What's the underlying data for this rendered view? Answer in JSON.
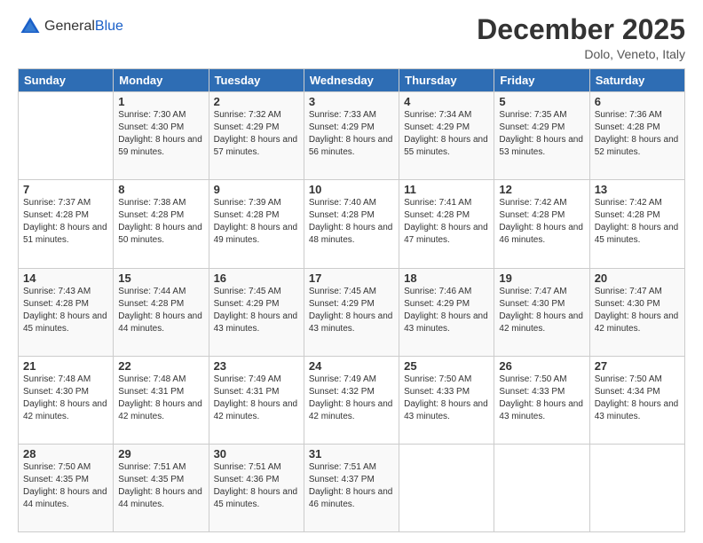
{
  "header": {
    "logo_general": "General",
    "logo_blue": "Blue",
    "month_title": "December 2025",
    "location": "Dolo, Veneto, Italy"
  },
  "days_of_week": [
    "Sunday",
    "Monday",
    "Tuesday",
    "Wednesday",
    "Thursday",
    "Friday",
    "Saturday"
  ],
  "weeks": [
    [
      {
        "day": "",
        "sunrise": "",
        "sunset": "",
        "daylight": ""
      },
      {
        "day": "1",
        "sunrise": "Sunrise: 7:30 AM",
        "sunset": "Sunset: 4:30 PM",
        "daylight": "Daylight: 8 hours and 59 minutes."
      },
      {
        "day": "2",
        "sunrise": "Sunrise: 7:32 AM",
        "sunset": "Sunset: 4:29 PM",
        "daylight": "Daylight: 8 hours and 57 minutes."
      },
      {
        "day": "3",
        "sunrise": "Sunrise: 7:33 AM",
        "sunset": "Sunset: 4:29 PM",
        "daylight": "Daylight: 8 hours and 56 minutes."
      },
      {
        "day": "4",
        "sunrise": "Sunrise: 7:34 AM",
        "sunset": "Sunset: 4:29 PM",
        "daylight": "Daylight: 8 hours and 55 minutes."
      },
      {
        "day": "5",
        "sunrise": "Sunrise: 7:35 AM",
        "sunset": "Sunset: 4:29 PM",
        "daylight": "Daylight: 8 hours and 53 minutes."
      },
      {
        "day": "6",
        "sunrise": "Sunrise: 7:36 AM",
        "sunset": "Sunset: 4:28 PM",
        "daylight": "Daylight: 8 hours and 52 minutes."
      }
    ],
    [
      {
        "day": "7",
        "sunrise": "Sunrise: 7:37 AM",
        "sunset": "Sunset: 4:28 PM",
        "daylight": "Daylight: 8 hours and 51 minutes."
      },
      {
        "day": "8",
        "sunrise": "Sunrise: 7:38 AM",
        "sunset": "Sunset: 4:28 PM",
        "daylight": "Daylight: 8 hours and 50 minutes."
      },
      {
        "day": "9",
        "sunrise": "Sunrise: 7:39 AM",
        "sunset": "Sunset: 4:28 PM",
        "daylight": "Daylight: 8 hours and 49 minutes."
      },
      {
        "day": "10",
        "sunrise": "Sunrise: 7:40 AM",
        "sunset": "Sunset: 4:28 PM",
        "daylight": "Daylight: 8 hours and 48 minutes."
      },
      {
        "day": "11",
        "sunrise": "Sunrise: 7:41 AM",
        "sunset": "Sunset: 4:28 PM",
        "daylight": "Daylight: 8 hours and 47 minutes."
      },
      {
        "day": "12",
        "sunrise": "Sunrise: 7:42 AM",
        "sunset": "Sunset: 4:28 PM",
        "daylight": "Daylight: 8 hours and 46 minutes."
      },
      {
        "day": "13",
        "sunrise": "Sunrise: 7:42 AM",
        "sunset": "Sunset: 4:28 PM",
        "daylight": "Daylight: 8 hours and 45 minutes."
      }
    ],
    [
      {
        "day": "14",
        "sunrise": "Sunrise: 7:43 AM",
        "sunset": "Sunset: 4:28 PM",
        "daylight": "Daylight: 8 hours and 45 minutes."
      },
      {
        "day": "15",
        "sunrise": "Sunrise: 7:44 AM",
        "sunset": "Sunset: 4:28 PM",
        "daylight": "Daylight: 8 hours and 44 minutes."
      },
      {
        "day": "16",
        "sunrise": "Sunrise: 7:45 AM",
        "sunset": "Sunset: 4:29 PM",
        "daylight": "Daylight: 8 hours and 43 minutes."
      },
      {
        "day": "17",
        "sunrise": "Sunrise: 7:45 AM",
        "sunset": "Sunset: 4:29 PM",
        "daylight": "Daylight: 8 hours and 43 minutes."
      },
      {
        "day": "18",
        "sunrise": "Sunrise: 7:46 AM",
        "sunset": "Sunset: 4:29 PM",
        "daylight": "Daylight: 8 hours and 43 minutes."
      },
      {
        "day": "19",
        "sunrise": "Sunrise: 7:47 AM",
        "sunset": "Sunset: 4:30 PM",
        "daylight": "Daylight: 8 hours and 42 minutes."
      },
      {
        "day": "20",
        "sunrise": "Sunrise: 7:47 AM",
        "sunset": "Sunset: 4:30 PM",
        "daylight": "Daylight: 8 hours and 42 minutes."
      }
    ],
    [
      {
        "day": "21",
        "sunrise": "Sunrise: 7:48 AM",
        "sunset": "Sunset: 4:30 PM",
        "daylight": "Daylight: 8 hours and 42 minutes."
      },
      {
        "day": "22",
        "sunrise": "Sunrise: 7:48 AM",
        "sunset": "Sunset: 4:31 PM",
        "daylight": "Daylight: 8 hours and 42 minutes."
      },
      {
        "day": "23",
        "sunrise": "Sunrise: 7:49 AM",
        "sunset": "Sunset: 4:31 PM",
        "daylight": "Daylight: 8 hours and 42 minutes."
      },
      {
        "day": "24",
        "sunrise": "Sunrise: 7:49 AM",
        "sunset": "Sunset: 4:32 PM",
        "daylight": "Daylight: 8 hours and 42 minutes."
      },
      {
        "day": "25",
        "sunrise": "Sunrise: 7:50 AM",
        "sunset": "Sunset: 4:33 PM",
        "daylight": "Daylight: 8 hours and 43 minutes."
      },
      {
        "day": "26",
        "sunrise": "Sunrise: 7:50 AM",
        "sunset": "Sunset: 4:33 PM",
        "daylight": "Daylight: 8 hours and 43 minutes."
      },
      {
        "day": "27",
        "sunrise": "Sunrise: 7:50 AM",
        "sunset": "Sunset: 4:34 PM",
        "daylight": "Daylight: 8 hours and 43 minutes."
      }
    ],
    [
      {
        "day": "28",
        "sunrise": "Sunrise: 7:50 AM",
        "sunset": "Sunset: 4:35 PM",
        "daylight": "Daylight: 8 hours and 44 minutes."
      },
      {
        "day": "29",
        "sunrise": "Sunrise: 7:51 AM",
        "sunset": "Sunset: 4:35 PM",
        "daylight": "Daylight: 8 hours and 44 minutes."
      },
      {
        "day": "30",
        "sunrise": "Sunrise: 7:51 AM",
        "sunset": "Sunset: 4:36 PM",
        "daylight": "Daylight: 8 hours and 45 minutes."
      },
      {
        "day": "31",
        "sunrise": "Sunrise: 7:51 AM",
        "sunset": "Sunset: 4:37 PM",
        "daylight": "Daylight: 8 hours and 46 minutes."
      },
      {
        "day": "",
        "sunrise": "",
        "sunset": "",
        "daylight": ""
      },
      {
        "day": "",
        "sunrise": "",
        "sunset": "",
        "daylight": ""
      },
      {
        "day": "",
        "sunrise": "",
        "sunset": "",
        "daylight": ""
      }
    ]
  ]
}
